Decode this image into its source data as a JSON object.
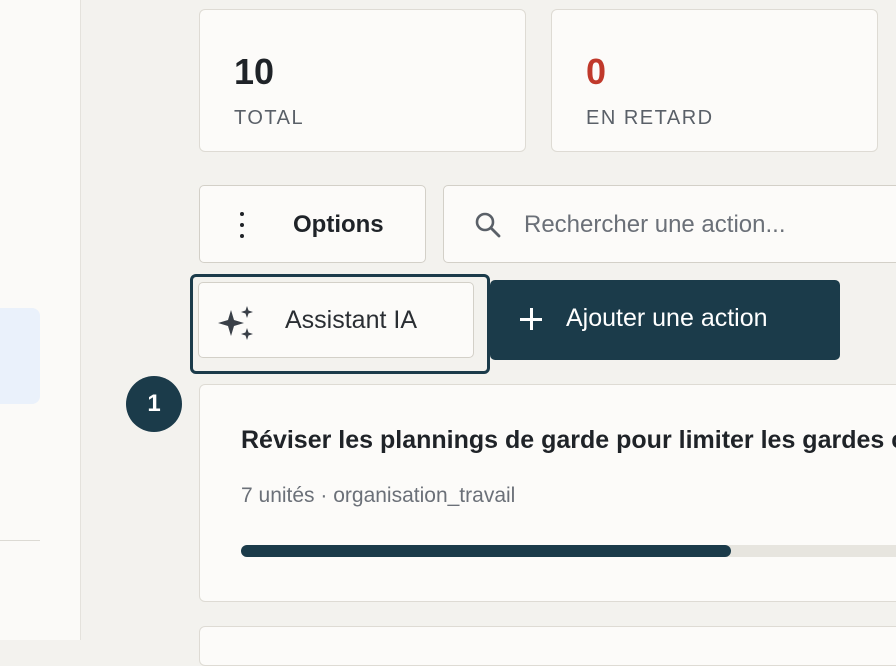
{
  "stats": {
    "total": {
      "value": "10",
      "label": "TOTAL"
    },
    "overdue": {
      "value": "0",
      "label": "EN RETARD",
      "color": "#c0392b"
    }
  },
  "toolbar": {
    "options_label": "Options",
    "search_placeholder": "Rechercher une action...",
    "ai_label": "Assistant IA",
    "add_label": "Ajouter une action"
  },
  "actions": [
    {
      "rank": "1",
      "title": "Réviser les plannings de garde pour limiter les gardes consécutives",
      "meta": "7 unités · organisation_travail",
      "progress": 0.72
    }
  ],
  "colors": {
    "accent": "#1b3b4a",
    "danger": "#c0392b"
  },
  "icons": {
    "options": "more-vertical-icon",
    "search": "search-icon",
    "ai": "sparkles-icon",
    "add": "plus-icon"
  }
}
